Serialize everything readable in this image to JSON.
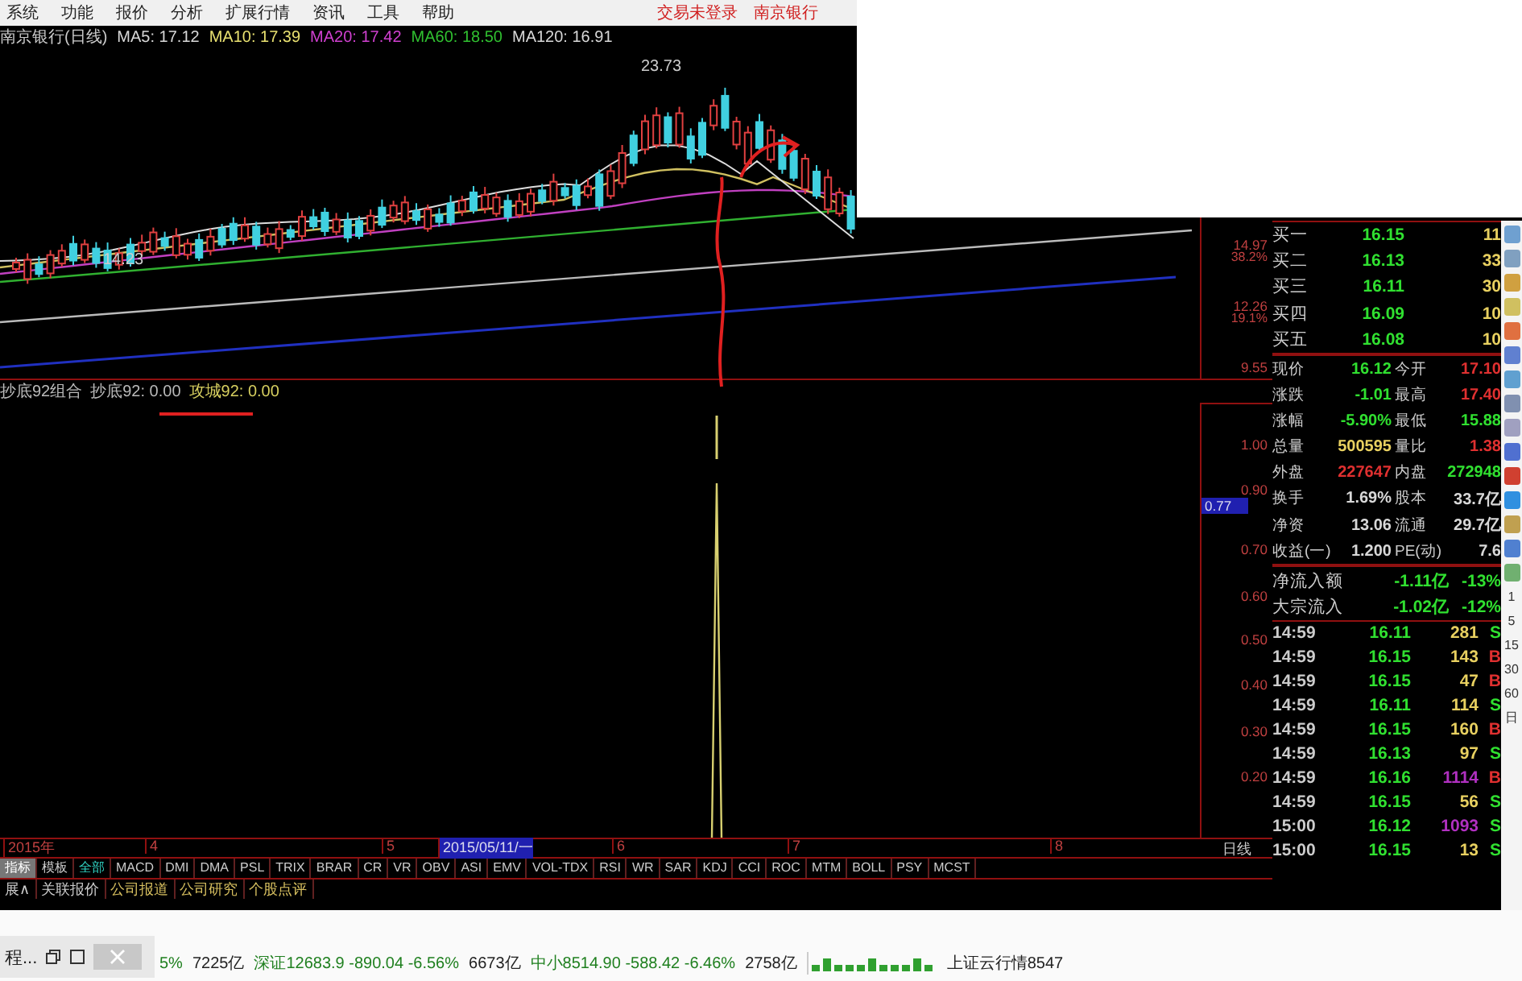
{
  "menu": {
    "items": [
      "系统",
      "功能",
      "报价",
      "分析",
      "扩展行情",
      "资讯",
      "工具",
      "帮助"
    ],
    "right": [
      "交易未登录",
      "南京银行"
    ]
  },
  "price_chart": {
    "title": "南京银行(日线)",
    "averages": [
      {
        "label": "MA5: 17.12",
        "color": "#d8d8d8"
      },
      {
        "label": "MA10: 17.39",
        "color": "#e8e070"
      },
      {
        "label": "MA20: 17.42",
        "color": "#d040d0"
      },
      {
        "label": "MA60: 18.50",
        "color": "#30c030"
      },
      {
        "label": "MA120: 16.91",
        "color": "#d8d8d8"
      }
    ],
    "high_label": "23.73",
    "low_label": "14.23",
    "axis": [
      {
        "label": "14.97",
        "kind": "price"
      },
      {
        "label": "38.2%",
        "kind": "ratio"
      },
      {
        "label": "12.26",
        "kind": "price"
      },
      {
        "label": "19.1%",
        "kind": "ratio"
      },
      {
        "label": "9.55",
        "kind": "price"
      }
    ]
  },
  "indicator": {
    "legend": [
      {
        "label": "抄底92组合",
        "kind": "name"
      },
      {
        "label": "抄底92: 0.00",
        "kind": "plain"
      },
      {
        "label": "攻城92: 0.00",
        "kind": "value"
      }
    ],
    "axis": [
      {
        "label": "1.00",
        "selected": false
      },
      {
        "label": "0.90",
        "selected": false
      },
      {
        "label": "0.77",
        "selected": true
      },
      {
        "label": "0.70",
        "selected": false
      },
      {
        "label": "0.60",
        "selected": false
      },
      {
        "label": "0.50",
        "selected": false
      },
      {
        "label": "0.40",
        "selected": false
      },
      {
        "label": "0.30",
        "selected": false
      },
      {
        "label": "0.20",
        "selected": false
      }
    ]
  },
  "date_axis": {
    "labels": [
      {
        "label": "2015年",
        "selected": false
      },
      {
        "label": "4",
        "selected": false
      },
      {
        "label": "5",
        "selected": false
      },
      {
        "label": "2015/05/11/一",
        "selected": true
      },
      {
        "label": "6",
        "selected": false
      },
      {
        "label": "7",
        "selected": false
      },
      {
        "label": "8",
        "selected": false
      }
    ],
    "period": "日线"
  },
  "indicator_tabs": [
    {
      "label": "指标",
      "selected": true,
      "kind": "mode"
    },
    {
      "label": "模板",
      "selected": false,
      "kind": "mode"
    },
    {
      "label": "全部",
      "selected": false,
      "kind": "group"
    },
    {
      "label": "MACD",
      "selected": false,
      "kind": "formula"
    },
    {
      "label": "DMI",
      "selected": false,
      "kind": "formula"
    },
    {
      "label": "DMA",
      "selected": false,
      "kind": "formula"
    },
    {
      "label": "PSL",
      "selected": false,
      "kind": "formula"
    },
    {
      "label": "TRIX",
      "selected": false,
      "kind": "formula"
    },
    {
      "label": "BRAR",
      "selected": false,
      "kind": "formula"
    },
    {
      "label": "CR",
      "selected": false,
      "kind": "formula"
    },
    {
      "label": "VR",
      "selected": false,
      "kind": "formula"
    },
    {
      "label": "OBV",
      "selected": false,
      "kind": "formula"
    },
    {
      "label": "ASI",
      "selected": false,
      "kind": "formula"
    },
    {
      "label": "EMV",
      "selected": false,
      "kind": "formula"
    },
    {
      "label": "VOL-TDX",
      "selected": false,
      "kind": "formula"
    },
    {
      "label": "RSI",
      "selected": false,
      "kind": "formula"
    },
    {
      "label": "WR",
      "selected": false,
      "kind": "formula"
    },
    {
      "label": "SAR",
      "selected": false,
      "kind": "formula"
    },
    {
      "label": "KDJ",
      "selected": false,
      "kind": "formula"
    },
    {
      "label": "CCI",
      "selected": false,
      "kind": "formula"
    },
    {
      "label": "ROC",
      "selected": false,
      "kind": "formula"
    },
    {
      "label": "MTM",
      "selected": false,
      "kind": "formula"
    },
    {
      "label": "BOLL",
      "selected": false,
      "kind": "formula"
    },
    {
      "label": "PSY",
      "selected": false,
      "kind": "formula"
    },
    {
      "label": "MCST",
      "selected": false,
      "kind": "formula"
    }
  ],
  "bottom_tabs": [
    {
      "label": "展∧",
      "kind": "plain"
    },
    {
      "label": "关联报价",
      "kind": "plain"
    },
    {
      "label": "公司报道",
      "kind": "news"
    },
    {
      "label": "公司研究",
      "kind": "news"
    },
    {
      "label": "个股点评",
      "kind": "news"
    }
  ],
  "order_book": [
    {
      "label": "买一",
      "price": "16.15",
      "volume": "11"
    },
    {
      "label": "买二",
      "price": "16.13",
      "volume": "33"
    },
    {
      "label": "买三",
      "price": "16.11",
      "volume": "30"
    },
    {
      "label": "买四",
      "price": "16.09",
      "volume": "10"
    },
    {
      "label": "买五",
      "price": "16.08",
      "volume": "10"
    }
  ],
  "stats": [
    {
      "cells": [
        {
          "label": "现价",
          "value": "16.12",
          "color": "#30e030"
        },
        {
          "label": "今开",
          "value": "17.10",
          "color": "#e03030"
        }
      ]
    },
    {
      "cells": [
        {
          "label": "涨跌",
          "value": "-1.01",
          "color": "#30e030"
        },
        {
          "label": "最高",
          "value": "17.40",
          "color": "#e03030"
        }
      ]
    },
    {
      "cells": [
        {
          "label": "涨幅",
          "value": "-5.90%",
          "color": "#30e030"
        },
        {
          "label": "最低",
          "value": "15.88",
          "color": "#30e030"
        }
      ]
    },
    {
      "cells": [
        {
          "label": "总量",
          "value": "500595",
          "color": "#e8d060"
        },
        {
          "label": "量比",
          "value": "1.38",
          "color": "#e03030"
        }
      ]
    },
    {
      "cells": [
        {
          "label": "外盘",
          "value": "227647",
          "color": "#e03030"
        },
        {
          "label": "内盘",
          "value": "272948",
          "color": "#30e030"
        }
      ]
    },
    {
      "cells": [
        {
          "label": "换手",
          "value": "1.69%",
          "color": "#d8d8d8"
        },
        {
          "label": "股本",
          "value": "33.7亿",
          "color": "#d8d8d8"
        }
      ]
    },
    {
      "cells": [
        {
          "label": "净资",
          "value": "13.06",
          "color": "#d8d8d8"
        },
        {
          "label": "流通",
          "value": "29.7亿",
          "color": "#d8d8d8"
        }
      ]
    },
    {
      "cells": [
        {
          "label": "收益(一)",
          "value": "1.200",
          "color": "#d8d8d8"
        },
        {
          "label": "PE(动)",
          "value": "7.6",
          "color": "#d8d8d8"
        }
      ]
    }
  ],
  "flows": [
    {
      "label": "净流入额",
      "value": "-1.11亿",
      "share": "-13%"
    },
    {
      "label": "大宗流入",
      "value": "-1.02亿",
      "share": "-12%"
    }
  ],
  "trades": [
    {
      "time": "14:59",
      "price": "16.11",
      "volume": "281",
      "side": "S",
      "color": "#e8d060"
    },
    {
      "time": "14:59",
      "price": "16.15",
      "volume": "143",
      "side": "B",
      "color": "#e8d060"
    },
    {
      "time": "14:59",
      "price": "16.15",
      "volume": "47",
      "side": "B",
      "color": "#e8d060"
    },
    {
      "time": "14:59",
      "price": "16.11",
      "volume": "114",
      "side": "S",
      "color": "#e8d060"
    },
    {
      "time": "14:59",
      "price": "16.15",
      "volume": "160",
      "side": "B",
      "color": "#e8d060"
    },
    {
      "time": "14:59",
      "price": "16.13",
      "volume": "97",
      "side": "S",
      "color": "#e8d060"
    },
    {
      "time": "14:59",
      "price": "16.16",
      "volume": "1114",
      "side": "B",
      "color": "#b030c0"
    },
    {
      "time": "14:59",
      "price": "16.15",
      "volume": "56",
      "side": "S",
      "color": "#e8d060"
    },
    {
      "time": "15:00",
      "price": "16.12",
      "volume": "1093",
      "side": "S",
      "color": "#b030c0"
    },
    {
      "time": "15:00",
      "price": "16.15",
      "volume": "13",
      "side": "S",
      "color": "#e8d060"
    }
  ],
  "side_toolbar": {
    "periods": [
      "1",
      "5",
      "15",
      "30",
      "60",
      "日"
    ]
  },
  "status_bar": {
    "window_title": "程...",
    "items": [
      {
        "text": "5%",
        "kind": "change"
      },
      {
        "text": "7225亿",
        "kind": "amount"
      },
      {
        "text": "深证12683.9 -890.04 -6.56%",
        "kind": "index"
      },
      {
        "text": "6673亿",
        "kind": "amount"
      },
      {
        "text": "中小8514.90 -588.42 -6.46%",
        "kind": "index"
      },
      {
        "text": "2758亿",
        "kind": "amount"
      }
    ],
    "cloud": "上证云行情8547"
  }
}
